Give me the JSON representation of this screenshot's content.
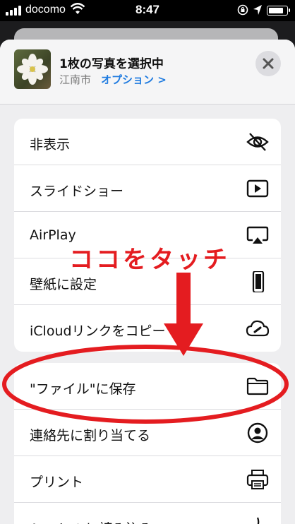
{
  "status_bar": {
    "carrier": "docomo",
    "time": "8:47",
    "battery_level": 0.85
  },
  "header": {
    "title": "1枚の写真を選択中",
    "location": "江南市",
    "options_label": "オプション >"
  },
  "group1": [
    {
      "label": "非表示",
      "icon": "eye-slash-icon"
    },
    {
      "label": "スライドショー",
      "icon": "play-icon"
    },
    {
      "label": "AirPlay",
      "icon": "airplay-icon"
    },
    {
      "label": "壁紙に設定",
      "icon": "phone-icon"
    },
    {
      "label": "iCloudリンクをコピー",
      "icon": "cloud-link-icon"
    }
  ],
  "group2": [
    {
      "label": "\"ファイル\"に保存",
      "icon": "folder-icon"
    },
    {
      "label": "連絡先に割り当てる",
      "icon": "person-circle-icon"
    },
    {
      "label": "プリント",
      "icon": "printer-icon"
    },
    {
      "label": "Acrobat に読み込み",
      "icon": "acrobat-icon"
    }
  ],
  "annotation": {
    "text": "ココをタッチ",
    "color": "#e41c20"
  }
}
